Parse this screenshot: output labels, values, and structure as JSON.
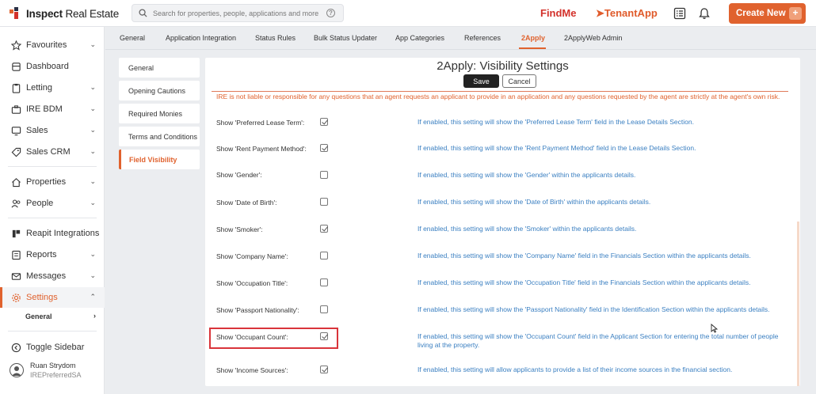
{
  "header": {
    "logo_word1": "Inspect",
    "logo_word2": "Real Estate",
    "search_placeholder": "Search for properties, people, applications and more!",
    "findme": "FindMe",
    "tenantapp": "TenantApp",
    "create_new": "Create New",
    "create_plus": "+"
  },
  "sidebar": {
    "items": [
      {
        "label": "Favourites",
        "icon": "star-icon",
        "chevron": true
      },
      {
        "label": "Dashboard",
        "icon": "home-icon",
        "chevron": false
      },
      {
        "label": "Letting",
        "icon": "clipboard-icon",
        "chevron": true
      },
      {
        "label": "IRE BDM",
        "icon": "briefcase-icon",
        "chevron": true
      },
      {
        "label": "Sales",
        "icon": "monitor-icon",
        "chevron": true
      },
      {
        "label": "Sales CRM",
        "icon": "tag-icon",
        "chevron": true
      },
      {
        "label": "Properties",
        "icon": "house-icon",
        "chevron": true
      },
      {
        "label": "People",
        "icon": "people-icon",
        "chevron": true
      },
      {
        "label": "Reapit Integrations",
        "icon": "reapit-icon",
        "chevron": false
      },
      {
        "label": "Reports",
        "icon": "report-icon",
        "chevron": true
      },
      {
        "label": "Messages",
        "icon": "mail-icon",
        "chevron": true
      },
      {
        "label": "Settings",
        "icon": "gear-icon",
        "chevron": true
      }
    ],
    "sub_item": "General",
    "toggle": "Toggle Sidebar",
    "user_name": "Ruan Strydom",
    "user_org": "IREPreferredSA"
  },
  "tabs": [
    "General",
    "Application Integration",
    "Status Rules",
    "Bulk Status Updater",
    "App Categories",
    "References",
    "2Apply",
    "2ApplyWeb Admin"
  ],
  "active_tab": "2Apply",
  "subnav": [
    "General",
    "Opening Cautions",
    "Required Monies",
    "Terms and Conditions",
    "Field Visibility"
  ],
  "active_subnav": "Field Visibility",
  "panel": {
    "title": "2Apply: Visibility Settings",
    "save": "Save",
    "cancel": "Cancel",
    "disclaimer": "IRE is not liable or responsible for any questions that an agent requests an applicant to provide in an application and any questions requested by the agent are strictly at the agent's own risk.",
    "rows": [
      {
        "label": "Show 'Preferred Lease Term':",
        "checked": true,
        "desc": "If enabled, this setting will show the 'Preferred Lease Term' field in the Lease Details Section."
      },
      {
        "label": "Show 'Rent Payment Method':",
        "checked": true,
        "desc": "If enabled, this setting will show the 'Rent Payment Method' field in the Lease Details Section."
      },
      {
        "label": "Show 'Gender':",
        "checked": false,
        "desc": "If enabled, this setting will show the 'Gender' within the applicants details."
      },
      {
        "label": "Show 'Date of Birth':",
        "checked": false,
        "desc": "If enabled, this setting will show the 'Date of Birth' within the applicants details."
      },
      {
        "label": "Show 'Smoker':",
        "checked": true,
        "desc": "If enabled, this setting will show the 'Smoker' within the applicants details."
      },
      {
        "label": "Show 'Company Name':",
        "checked": false,
        "desc": "If enabled, this setting will show the 'Company Name' field in the Financials Section within the applicants details."
      },
      {
        "label": "Show 'Occupation Title':",
        "checked": false,
        "desc": "If enabled, this setting will show the 'Occupation Title' field in the Financials Section within the applicants details."
      },
      {
        "label": "Show 'Passport Nationality':",
        "checked": false,
        "desc": "If enabled, this setting will show the 'Passport Nationality' field in the Identification Section within the applicants details."
      },
      {
        "label": "Show 'Occupant Count':",
        "checked": true,
        "desc": "If enabled, this setting will show the 'Occupant Count' field in the Applicant Section for entering the total number of people living at the property."
      },
      {
        "label": "Show 'Income Sources':",
        "checked": true,
        "desc": "If enabled, this setting will allow applicants to provide a list of their income sources in the financial section."
      }
    ]
  },
  "colors": {
    "accent": "#e0622e",
    "link_blue": "#3a7fc1",
    "findme_red": "#d3312b",
    "highlight_red": "#d9343a"
  }
}
